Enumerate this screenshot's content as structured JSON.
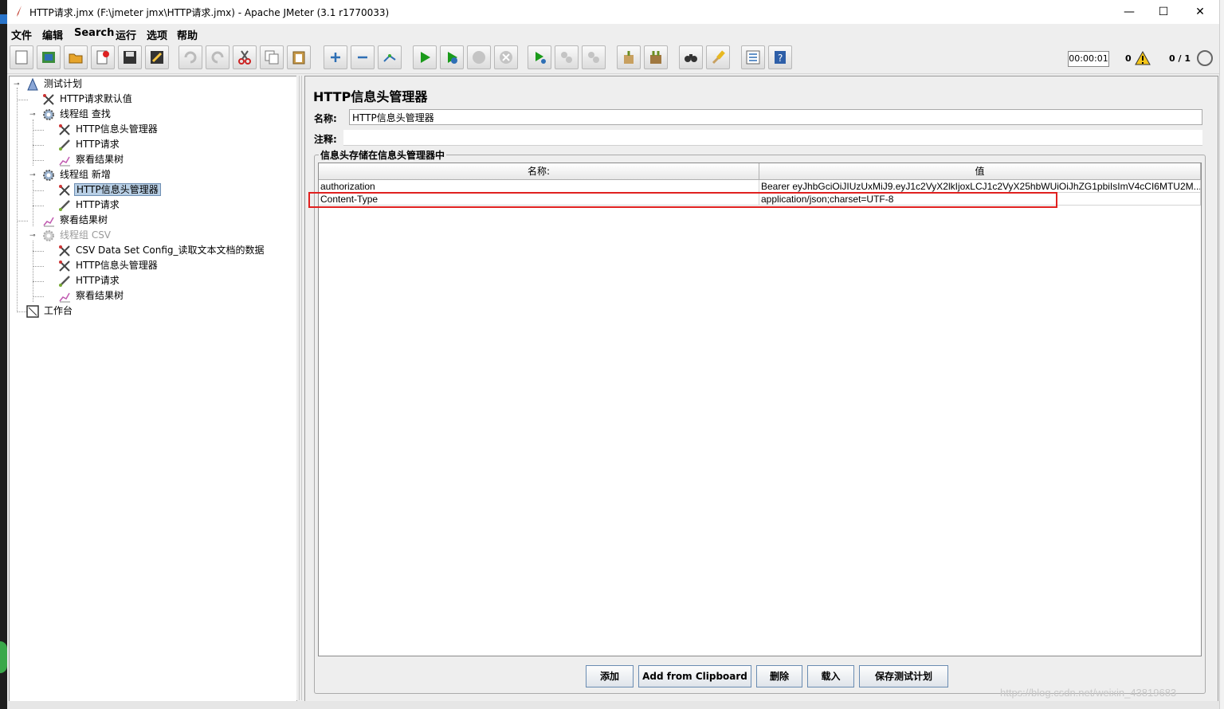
{
  "window": {
    "title": "HTTP请求.jmx (F:\\jmeter jmx\\HTTP请求.jmx) - Apache JMeter (3.1 r1770033)",
    "minimize": "—",
    "maximize": "☐",
    "close": "✕"
  },
  "menu": [
    "文件",
    "编辑",
    "Search",
    "运行",
    "选项",
    "帮助"
  ],
  "toolbar": {
    "timer": "00:00:01",
    "error_count": "0",
    "threads": "0 / 1"
  },
  "tree": [
    {
      "label": "测试计划",
      "icon": "test-plan-icon"
    },
    {
      "label": "HTTP请求默认值",
      "icon": "config-element-icon"
    },
    {
      "label": "线程组 查找",
      "icon": "thread-group-icon"
    },
    {
      "label": "HTTP信息头管理器",
      "icon": "config-element-icon"
    },
    {
      "label": "HTTP请求",
      "icon": "sampler-icon"
    },
    {
      "label": "察看结果树",
      "icon": "listener-icon"
    },
    {
      "label": "线程组 新增",
      "icon": "thread-group-icon"
    },
    {
      "label": "HTTP信息头管理器",
      "icon": "config-element-icon"
    },
    {
      "label": "HTTP请求",
      "icon": "sampler-icon"
    },
    {
      "label": "察看结果树",
      "icon": "listener-icon"
    },
    {
      "label": "线程组  CSV",
      "icon": "thread-group-icon"
    },
    {
      "label": "CSV Data Set Config_读取文本文档的数据",
      "icon": "config-element-icon"
    },
    {
      "label": "HTTP信息头管理器",
      "icon": "config-element-icon"
    },
    {
      "label": "HTTP请求",
      "icon": "sampler-icon"
    },
    {
      "label": "察看结果树",
      "icon": "listener-icon"
    },
    {
      "label": "工作台",
      "icon": "workbench-icon"
    }
  ],
  "panel": {
    "title": "HTTP信息头管理器",
    "name_label": "名称:",
    "name_value": "HTTP信息头管理器",
    "comment_label": "注释:",
    "group_title": "信息头存储在信息头管理器中",
    "table": {
      "headers": [
        "名称:",
        "值"
      ],
      "rows": [
        [
          "authorization",
          "Bearer eyJhbGciOiJIUzUxMiJ9.eyJ1c2VyX2lkIjoxLCJ1c2VyX25hbWUiOiJhZG1pbiIsImV4cCI6MTU2M..."
        ],
        [
          "Content-Type",
          "application/json;charset=UTF-8"
        ]
      ]
    },
    "buttons": {
      "add": "添加",
      "clipboard": "Add from Clipboard",
      "delete": "删除",
      "load": "载入",
      "save": "保存测试计划"
    }
  },
  "watermark": "https://blog.csdn.net/weixin_43819683"
}
